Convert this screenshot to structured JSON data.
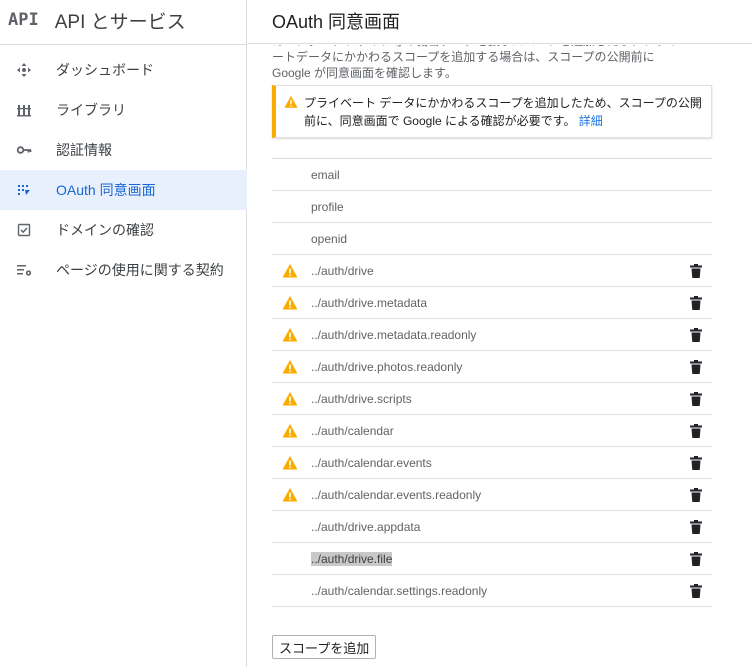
{
  "brand": {
    "logo": "API",
    "title": "API とサービス"
  },
  "sidebar": {
    "items": [
      {
        "label": "ダッシュボード",
        "icon": "dashboard-icon",
        "active": false
      },
      {
        "label": "ライブラリ",
        "icon": "library-icon",
        "active": false
      },
      {
        "label": "認証情報",
        "icon": "key-icon",
        "active": false
      },
      {
        "label": "OAuth 同意画面",
        "icon": "consent-screen-icon",
        "active": true
      },
      {
        "label": "ドメインの確認",
        "icon": "checkbox-icon",
        "active": false
      },
      {
        "label": "ページの使用に関する契約",
        "icon": "settings-list-icon",
        "active": false
      }
    ]
  },
  "header": {
    "title": "OAuth 同意画面"
  },
  "main": {
    "intro": "カレンダー、ドライブ等の機密データを扱うスコープを追加したり、プライベートデータにかかわるスコープを追加する場合は、スコープの公開前に Google が同意画面を確認します。",
    "notice": {
      "text": "プライベート データにかかわるスコープを追加したため、スコープの公開前に、同意画面で Google による確認が必要です。",
      "link": "詳細"
    },
    "scopes": [
      {
        "name": "email",
        "warning": false,
        "deletable": false,
        "selected": false
      },
      {
        "name": "profile",
        "warning": false,
        "deletable": false,
        "selected": false
      },
      {
        "name": "openid",
        "warning": false,
        "deletable": false,
        "selected": false
      },
      {
        "name": "../auth/drive",
        "warning": true,
        "deletable": true,
        "selected": false
      },
      {
        "name": "../auth/drive.metadata",
        "warning": true,
        "deletable": true,
        "selected": false
      },
      {
        "name": "../auth/drive.metadata.readonly",
        "warning": true,
        "deletable": true,
        "selected": false
      },
      {
        "name": "../auth/drive.photos.readonly",
        "warning": true,
        "deletable": true,
        "selected": false
      },
      {
        "name": "../auth/drive.scripts",
        "warning": true,
        "deletable": true,
        "selected": false
      },
      {
        "name": "../auth/calendar",
        "warning": true,
        "deletable": true,
        "selected": false
      },
      {
        "name": "../auth/calendar.events",
        "warning": true,
        "deletable": true,
        "selected": false
      },
      {
        "name": "../auth/calendar.events.readonly",
        "warning": true,
        "deletable": true,
        "selected": false
      },
      {
        "name": "../auth/drive.appdata",
        "warning": false,
        "deletable": true,
        "selected": false
      },
      {
        "name": "../auth/drive.file",
        "warning": false,
        "deletable": true,
        "selected": true
      },
      {
        "name": "../auth/calendar.settings.readonly",
        "warning": false,
        "deletable": true,
        "selected": false
      }
    ],
    "add_scope_label": "スコープを追加"
  },
  "colors": {
    "accent": "#1967d2",
    "active_bg": "#e8f0fe",
    "warning": "#f9ab00",
    "link": "#1a73e8"
  }
}
